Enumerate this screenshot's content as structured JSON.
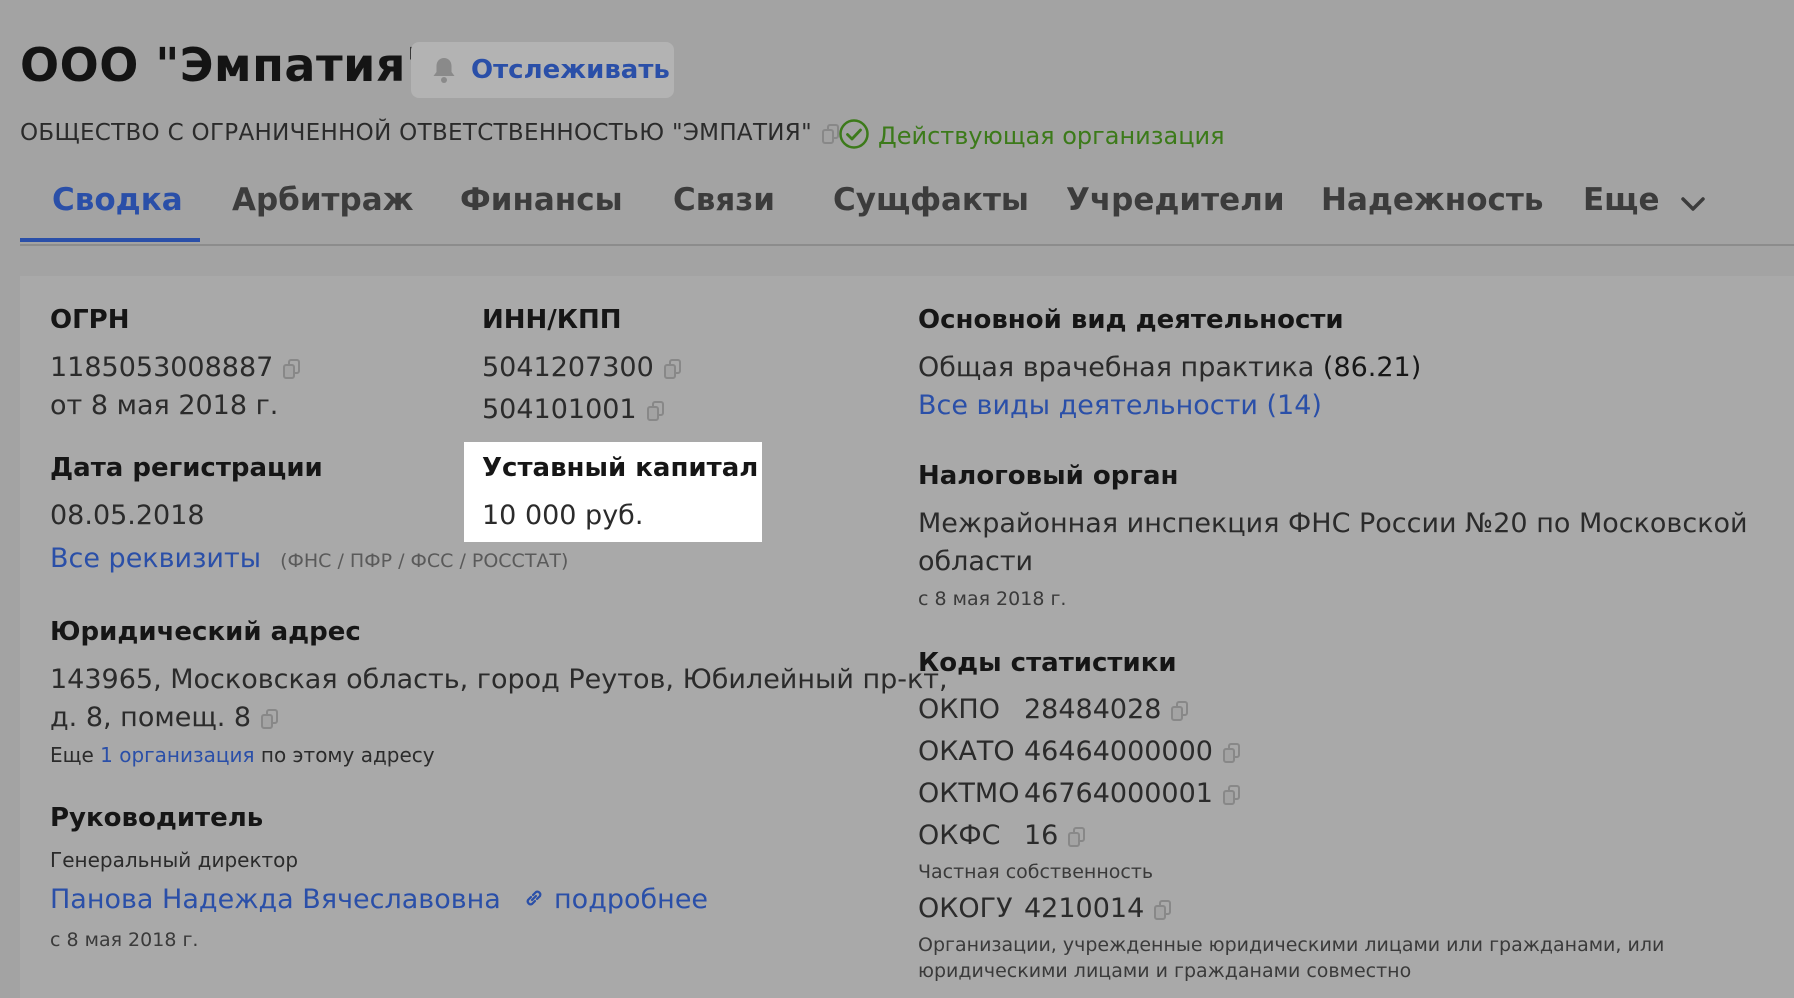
{
  "header": {
    "title": "ООО \"Эмпатия\"",
    "follow_label": "Отслеживать",
    "full_name": "ОБЩЕСТВО С ОГРАНИЧЕННОЙ ОТВЕТСТВЕННОСТЬЮ \"ЭМПАТИЯ\"",
    "status": "Действующая организация"
  },
  "tabs": [
    {
      "label": "Сводка"
    },
    {
      "label": "Арбитраж"
    },
    {
      "label": "Финансы"
    },
    {
      "label": "Связи"
    },
    {
      "label": "Сущфакты"
    },
    {
      "label": "Учредители"
    },
    {
      "label": "Надежность"
    },
    {
      "label": "Еще"
    }
  ],
  "left": {
    "ogrn": {
      "label": "ОГРН",
      "value": "1185053008887",
      "date": "от 8 мая 2018 г."
    },
    "inn_kpp": {
      "label": "ИНН/КПП",
      "inn": "5041207300",
      "kpp": "504101001"
    },
    "reg_date": {
      "label": "Дата регистрации",
      "value": "08.05.2018"
    },
    "capital": {
      "label": "Уставный капитал",
      "value": "10 000 руб."
    },
    "requisites": {
      "link": "Все реквизиты",
      "note": "(ФНС / ПФР / ФСС / РОССТАТ)"
    },
    "address": {
      "label": "Юридический адрес",
      "line1": "143965, Московская область, город Реутов, Юбилейный пр-кт,",
      "line2": "д. 8, помещ. 8",
      "more_prefix": "Еще",
      "more_link": "1 организация",
      "more_suffix": "по этому адресу"
    },
    "director": {
      "label": "Руководитель",
      "position": "Генеральный директор",
      "name": "Панова Надежда Вячеславовна",
      "more": "подробнее",
      "since": "с 8 мая 2018 г."
    }
  },
  "right": {
    "activity": {
      "label": "Основной вид деятельности",
      "value": "Общая врачебная практика",
      "code": "(86.21)",
      "all_link": "Все виды деятельности (14)"
    },
    "tax": {
      "label": "Налоговый орган",
      "line1": "Межрайонная инспекция ФНС России №20 по Московской",
      "line2": "области",
      "since": "с 8 мая 2018 г."
    },
    "stats": {
      "label": "Коды статистики",
      "okpo": {
        "code": "ОКПО",
        "value": "28484028"
      },
      "okato": {
        "code": "ОКАТО",
        "value": "46464000000"
      },
      "oktmo": {
        "code": "ОКТМО",
        "value": "46764000001"
      },
      "okfs": {
        "code": "ОКФС",
        "value": "16",
        "desc": "Частная собственность"
      },
      "okogu": {
        "code": "ОКОГУ",
        "value": "4210014",
        "desc1": "Организации, учрежденные юридическими лицами или гражданами, или",
        "desc2": "юридическими лицами и гражданами совместно"
      }
    }
  }
}
